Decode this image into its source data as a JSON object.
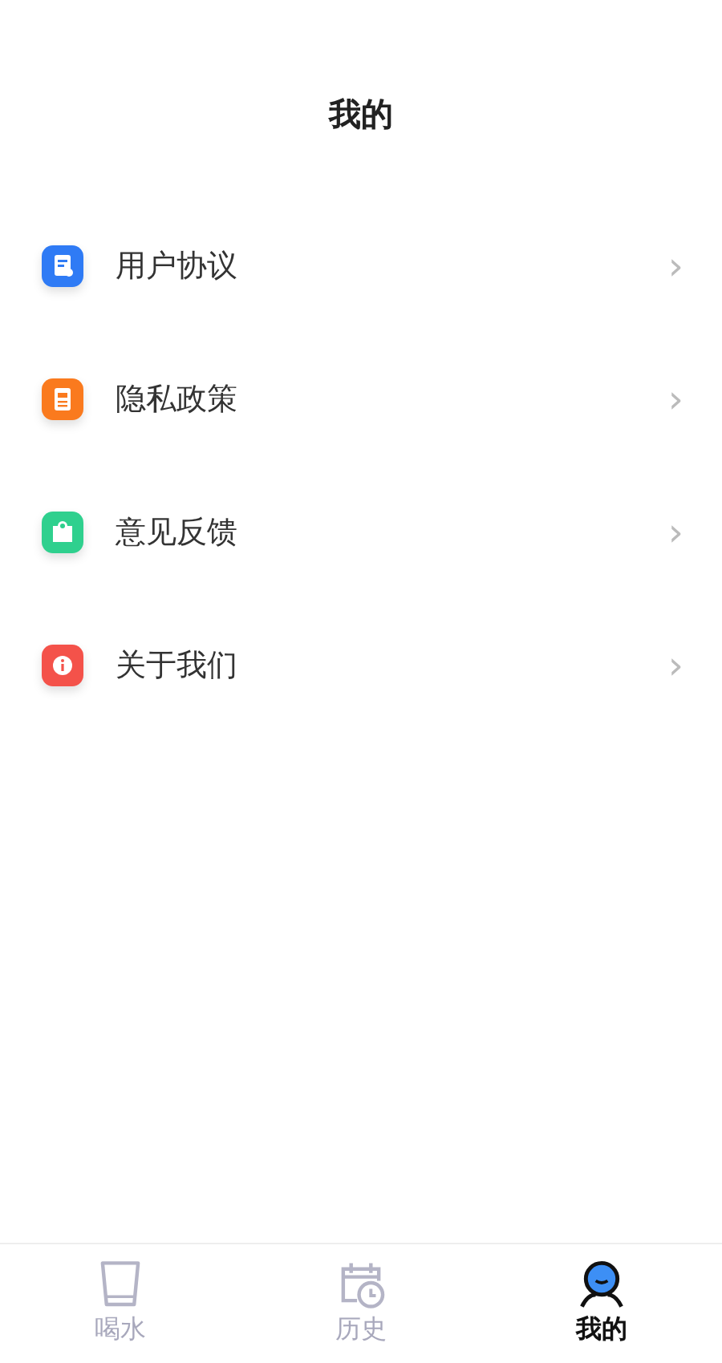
{
  "title": "我的",
  "menu": [
    {
      "label": "用户协议",
      "kind": "document",
      "color": "#2f7bf5",
      "chevron": "›"
    },
    {
      "label": "隐私政策",
      "kind": "card",
      "color": "#fa7a1e",
      "chevron": "›"
    },
    {
      "label": "意见反馈",
      "kind": "feedback",
      "color": "#2fd08e",
      "chevron": "›"
    },
    {
      "label": "关于我们",
      "kind": "info",
      "color": "#f4524a",
      "chevron": "›"
    }
  ],
  "tabs": [
    {
      "label": "喝水",
      "kind": "cup",
      "selected": false
    },
    {
      "label": "历史",
      "kind": "calendar",
      "selected": false
    },
    {
      "label": "我的",
      "kind": "person",
      "selected": true
    }
  ]
}
